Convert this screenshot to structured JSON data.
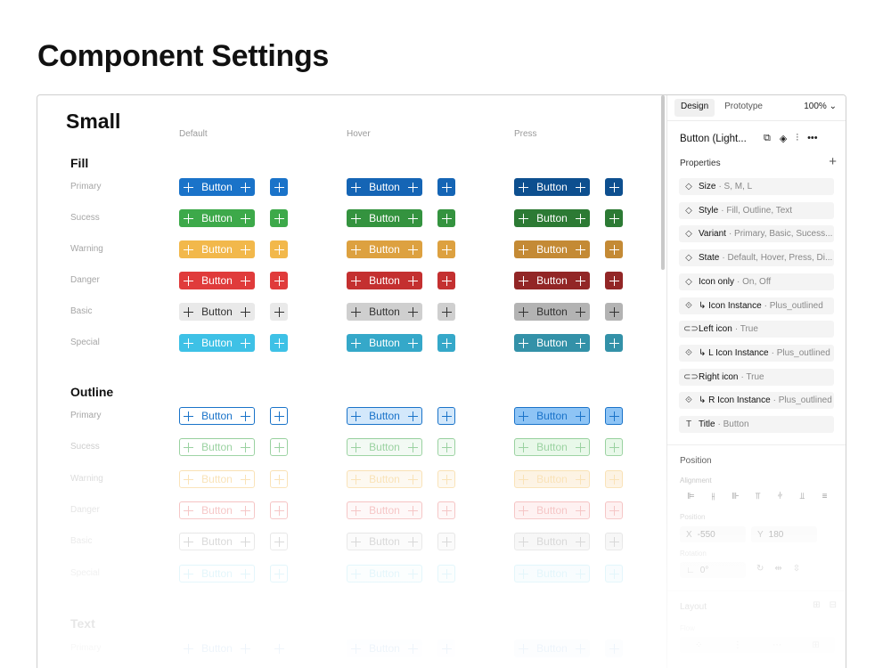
{
  "page_title": "Component Settings",
  "canvas": {
    "size_title": "Small",
    "columns": [
      "Default",
      "Hover",
      "Press"
    ],
    "button_label": "Button",
    "sections": [
      {
        "title": "Fill",
        "kind": "fill",
        "rows": [
          {
            "label": "Primary",
            "default": "#1a73c9",
            "hover": "#1565b5",
            "press": "#0d4f8f"
          },
          {
            "label": "Sucess",
            "default": "#3da94a",
            "hover": "#34933f",
            "press": "#2c7a34"
          },
          {
            "label": "Warning",
            "default": "#f2b84b",
            "hover": "#dda140",
            "press": "#c48a35"
          },
          {
            "label": "Danger",
            "default": "#e03b3b",
            "hover": "#c43030",
            "press": "#922626"
          },
          {
            "label": "Basic",
            "default": "#e9e9e9",
            "hover": "#cfcfcf",
            "press": "#b3b3b3"
          },
          {
            "label": "Special",
            "default": "#3ec1e6",
            "hover": "#35a8c9",
            "press": "#3391a8"
          }
        ]
      },
      {
        "title": "Outline",
        "kind": "outline",
        "rows": [
          {
            "label": "Primary",
            "stroke": "#1a73c9",
            "hover_bg": "#d3e8fb",
            "press_bg": "#8ec4f5"
          },
          {
            "label": "Sucess",
            "stroke": "#3da94a",
            "hover_bg": "#e9f7ea",
            "press_bg": "#d4f3d6"
          },
          {
            "label": "Warning",
            "stroke": "#f2b84b",
            "hover_bg": "#fdf1dc",
            "press_bg": "#fbe3bd"
          },
          {
            "label": "Danger",
            "stroke": "#e03b3b",
            "hover_bg": "#fde7e7",
            "press_bg": "#fbd1d1"
          },
          {
            "label": "Basic",
            "stroke": "#9a9a9a",
            "hover_bg": "#eeeeee",
            "press_bg": "#dddddd"
          },
          {
            "label": "Special",
            "stroke": "#3ec1e6",
            "hover_bg": "#e6f7fc",
            "press_bg": "#cdeff9"
          }
        ]
      },
      {
        "title": "Text",
        "kind": "text",
        "rows": [
          {
            "label": "Primary",
            "stroke": "#1a73c9",
            "hover_bg": "#eef5fd",
            "press_bg": "#d8e9fb"
          }
        ]
      }
    ]
  },
  "panel": {
    "tabs": [
      {
        "label": "Design",
        "active": true
      },
      {
        "label": "Prototype",
        "active": false
      }
    ],
    "zoom": "100%",
    "component_name": "Button (Light...",
    "properties_title": "Properties",
    "properties": [
      {
        "icon": "variant-icon",
        "glyph": "◇",
        "name": "Size",
        "value": "S, M, L"
      },
      {
        "icon": "variant-icon",
        "glyph": "◇",
        "name": "Style",
        "value": "Fill, Outline, Text"
      },
      {
        "icon": "variant-icon",
        "glyph": "◇",
        "name": "Variant",
        "value": "Primary, Basic, Sucess..."
      },
      {
        "icon": "variant-icon",
        "glyph": "◇",
        "name": "State",
        "value": "Default, Hover, Press, Di..."
      },
      {
        "icon": "variant-icon",
        "glyph": "◇",
        "name": "Icon only",
        "value": "On, Off"
      },
      {
        "icon": "instance-icon",
        "glyph": "⟐",
        "name": "↳ Icon Instance",
        "value": "Plus_outlined"
      },
      {
        "icon": "toggle-icon",
        "glyph": "⊂⊃",
        "name": "Left icon",
        "value": "True"
      },
      {
        "icon": "instance-icon",
        "glyph": "⟐",
        "name": "↳ L Icon Instance",
        "value": "Plus_outlined"
      },
      {
        "icon": "toggle-icon",
        "glyph": "⊂⊃",
        "name": "Right icon",
        "value": "True"
      },
      {
        "icon": "instance-icon",
        "glyph": "⟐",
        "name": "↳ R Icon Instance",
        "value": "Plus_outlined"
      },
      {
        "icon": "text-icon",
        "glyph": "T",
        "name": "Title",
        "value": "Button"
      }
    ],
    "position_title": "Position",
    "alignment_label": "Alignment",
    "position_label": "Position",
    "x_label": "X",
    "x_value": "-550",
    "y_label": "Y",
    "y_value": "180",
    "rotation_label": "Rotation",
    "rotation_value": "0°",
    "layout_title": "Layout",
    "flow_label": "Flow"
  }
}
